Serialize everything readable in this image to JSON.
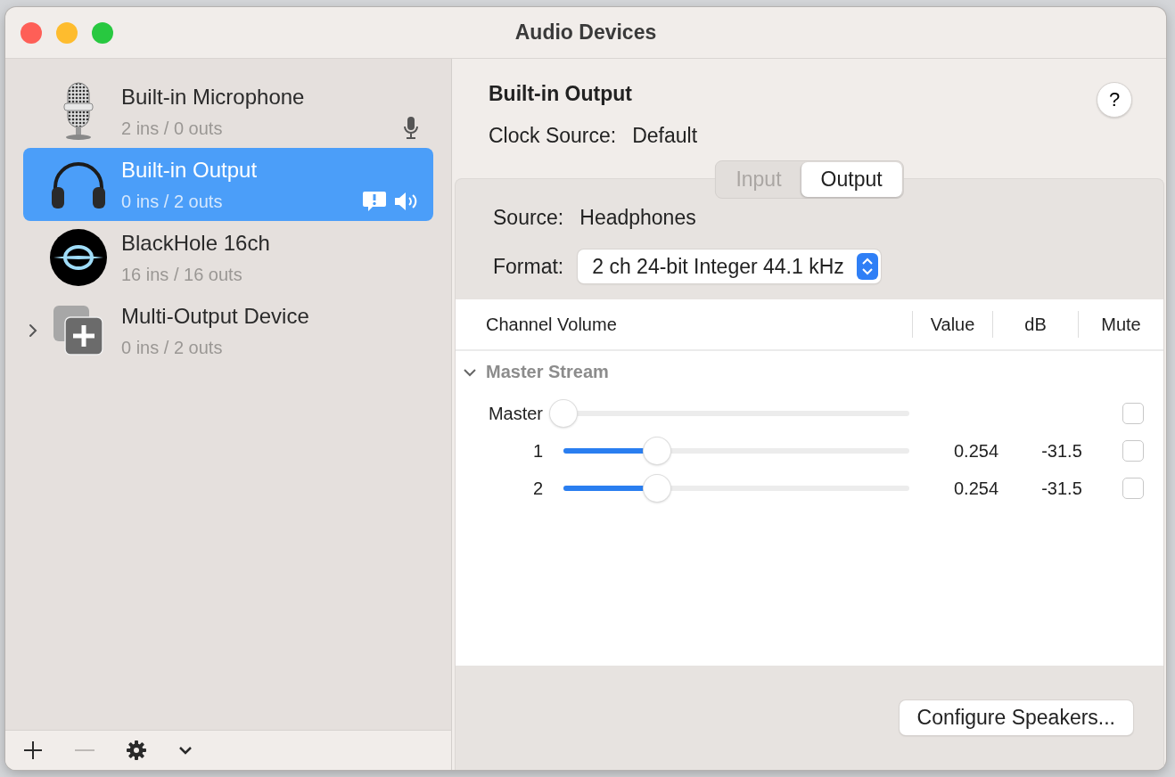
{
  "window": {
    "title": "Audio Devices"
  },
  "devices": [
    {
      "name": "Built-in Microphone",
      "io": "2 ins / 0 outs",
      "kind": "microphone",
      "selected": false,
      "expandable": false,
      "status": [
        {
          "kind": "input"
        }
      ]
    },
    {
      "name": "Built-in Output",
      "io": "0 ins / 2 outs",
      "kind": "headphones",
      "selected": true,
      "expandable": false,
      "status": [
        {
          "kind": "alert"
        },
        {
          "kind": "output"
        }
      ]
    },
    {
      "name": "BlackHole 16ch",
      "io": "16 ins / 16 outs",
      "kind": "virtual",
      "selected": false,
      "expandable": false
    },
    {
      "name": "Multi-Output Device",
      "io": "0 ins / 2 outs",
      "kind": "aggregate",
      "selected": false,
      "expandable": true
    }
  ],
  "toolbar": [
    {
      "kind": "add",
      "disabled": false
    },
    {
      "kind": "remove",
      "disabled": true
    },
    {
      "kind": "gear",
      "disabled": false
    },
    {
      "kind": "menu",
      "disabled": false
    }
  ],
  "detail": {
    "title": "Built-in Output",
    "help_label": "?",
    "clock_label": "Clock Source:",
    "clock_value": "Default",
    "tabs": [
      {
        "label": "Input",
        "selected": false
      },
      {
        "label": "Output",
        "selected": true
      }
    ],
    "source_label": "Source:",
    "source_value": "Headphones",
    "format_label": "Format:",
    "format_value": "2 ch 24-bit Integer 44.1 kHz",
    "table": {
      "columns": [
        "Channel Volume",
        "Value",
        "dB",
        "Mute"
      ],
      "group": {
        "name": "Master Stream",
        "expanded": true
      },
      "rows": [
        {
          "name": "Master",
          "level": 0,
          "muted": false
        },
        {
          "name": "1",
          "level": 0.27,
          "value": "0.254",
          "db": "-31.5",
          "muted": false
        },
        {
          "name": "2",
          "level": 0.27,
          "value": "0.254",
          "db": "-31.5",
          "muted": false
        }
      ]
    },
    "configure_button": "Configure Speakers..."
  }
}
